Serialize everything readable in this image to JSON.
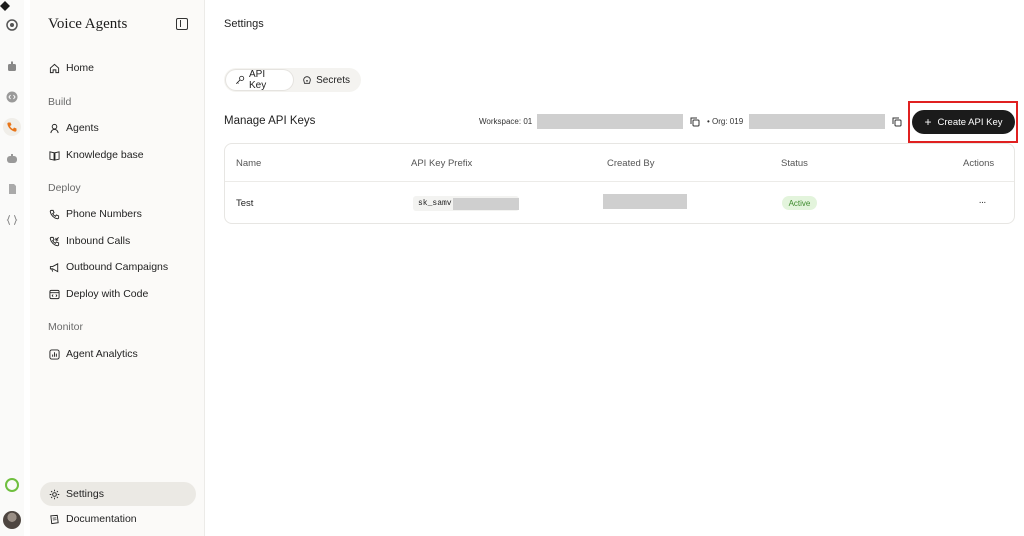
{
  "sidebar": {
    "brand": "Voice Agents",
    "items": {
      "home": "Home",
      "agents": "Agents",
      "knowledge_base": "Knowledge base",
      "phone_numbers": "Phone Numbers",
      "inbound_calls": "Inbound Calls",
      "outbound_campaigns": "Outbound Campaigns",
      "deploy_with_code": "Deploy with Code",
      "agent_analytics": "Agent Analytics",
      "settings": "Settings",
      "documentation": "Documentation"
    },
    "sections": {
      "build": "Build",
      "deploy": "Deploy",
      "monitor": "Monitor"
    },
    "active_item": "settings"
  },
  "rail": {
    "icons": [
      "logo-icon",
      "robot-icon",
      "code-icon",
      "phone-icon",
      "gamepad-icon",
      "file-icon",
      "braces-icon",
      "status-ring-icon",
      "avatar"
    ],
    "active_icon": "phone-icon",
    "accent_color": "#e8761a",
    "status_color": "#6fbf3f"
  },
  "main": {
    "page_title": "Settings",
    "tabs": {
      "api_key": "API Key",
      "secrets": "Secrets"
    },
    "selected_tab": "api_key",
    "manage_title": "Manage API Keys",
    "workspace_label": "Workspace: 01",
    "org_label": "• Org: 019",
    "create_button": "Create API Key",
    "table": {
      "headers": {
        "name": "Name",
        "prefix": "API Key Prefix",
        "created_by": "Created By",
        "status": "Status",
        "actions": "Actions"
      },
      "rows": [
        {
          "name": "Test",
          "prefix": "sk_samv",
          "status": "Active",
          "actions": "···"
        }
      ]
    }
  }
}
